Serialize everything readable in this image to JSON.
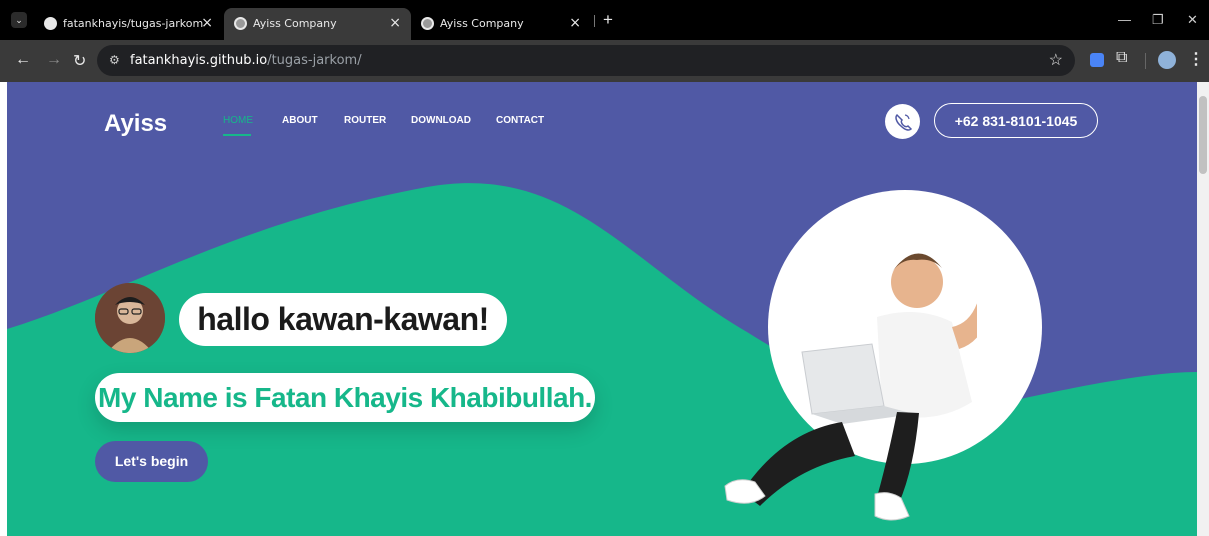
{
  "browser": {
    "tabs": [
      {
        "title": "fatankhayis/tugas-jarkom",
        "active": false
      },
      {
        "title": "Ayiss Company",
        "active": true
      },
      {
        "title": "Ayiss Company",
        "active": false
      }
    ],
    "new_tab_label": "+",
    "url_host": "fatankhayis.github.io",
    "url_path": "/tugas-jarkom/"
  },
  "site": {
    "logo": "Ayiss",
    "nav": [
      "HOME",
      "ABOUT",
      "ROUTER",
      "DOWNLOAD",
      "CONTACT"
    ],
    "phone": "+62 831-8101-1045",
    "greeting": "hallo kawan-kawan!",
    "name_line": "My Name is Fatan Khayis Khabibullah.",
    "cta": "Let's begin"
  },
  "colors": {
    "primary": "#5059a5",
    "accent": "#16b78a",
    "browser_dark": "#000000",
    "toolbar": "#3a3a3a"
  },
  "icons": [
    "github-icon",
    "globe-icon",
    "phone-icon",
    "star-icon",
    "extension-icon"
  ]
}
